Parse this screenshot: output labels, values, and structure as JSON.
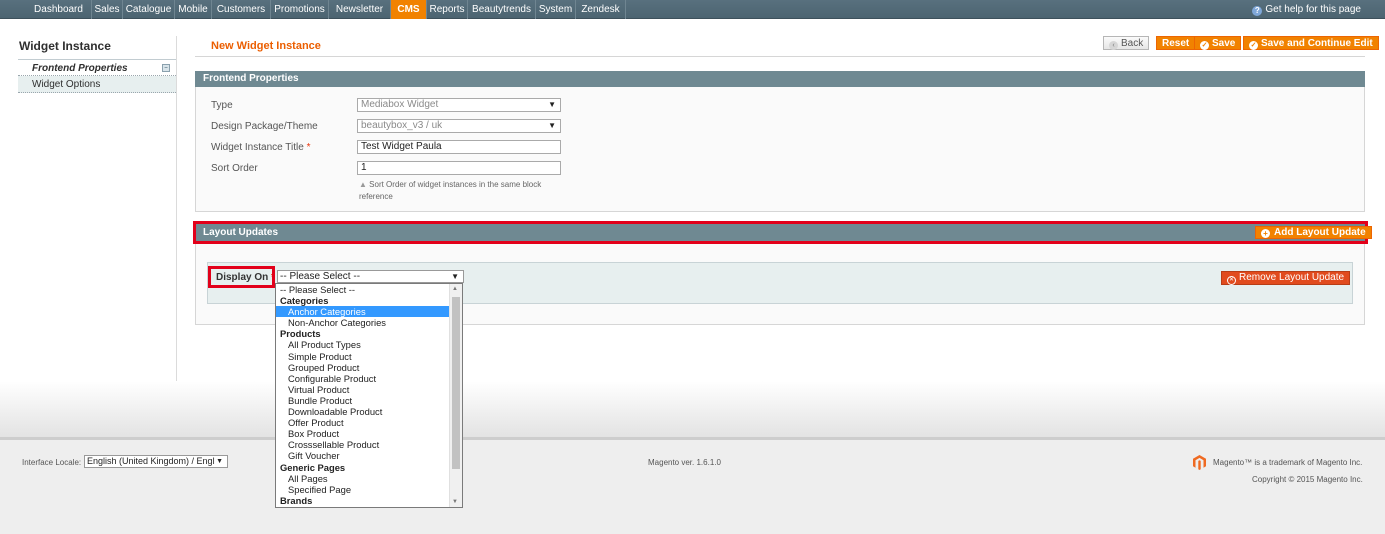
{
  "nav": {
    "items": [
      "Dashboard",
      "Sales",
      "Catalogue",
      "Mobile",
      "Customers",
      "Promotions",
      "Newsletter",
      "CMS",
      "Reports",
      "Beautytrends",
      "System",
      "Zendesk"
    ],
    "active": "CMS",
    "help": "Get help for this page",
    "help_icon": "question-circle-icon"
  },
  "sidebar": {
    "title": "Widget Instance",
    "tabs": [
      {
        "label": "Frontend Properties",
        "active": true
      },
      {
        "label": "Widget Options",
        "active": false
      }
    ]
  },
  "header": {
    "title": "New Widget Instance",
    "buttons": {
      "back": "Back",
      "reset": "Reset",
      "save": "Save",
      "save_continue": "Save and Continue Edit"
    }
  },
  "frontend": {
    "heading": "Frontend Properties",
    "type": {
      "label": "Type",
      "value": "Mediabox Widget"
    },
    "design": {
      "label": "Design Package/Theme",
      "value": "beautybox_v3 / uk"
    },
    "title": {
      "label": "Widget Instance Title",
      "required_mark": "*",
      "value": "Test Widget Paula"
    },
    "sort": {
      "label": "Sort Order",
      "value": "1",
      "note": "Sort Order of widget instances in the same block reference"
    }
  },
  "layout_updates": {
    "heading": "Layout Updates",
    "add_button": "Add Layout Update",
    "display_on_label": "Display On",
    "required_mark": "*",
    "display_on_value": "-- Please Select --",
    "remove_button": "Remove Layout Update",
    "options": [
      {
        "label": "-- Please Select --",
        "kind": "option"
      },
      {
        "label": "Categories",
        "kind": "group"
      },
      {
        "label": "Anchor Categories",
        "kind": "child",
        "highlighted": true
      },
      {
        "label": "Non-Anchor Categories",
        "kind": "child"
      },
      {
        "label": "Products",
        "kind": "group"
      },
      {
        "label": "All Product Types",
        "kind": "child"
      },
      {
        "label": "Simple Product",
        "kind": "child"
      },
      {
        "label": "Grouped Product",
        "kind": "child"
      },
      {
        "label": "Configurable Product",
        "kind": "child"
      },
      {
        "label": "Virtual Product",
        "kind": "child"
      },
      {
        "label": "Bundle Product",
        "kind": "child"
      },
      {
        "label": "Downloadable Product",
        "kind": "child"
      },
      {
        "label": "Offer Product",
        "kind": "child"
      },
      {
        "label": "Box Product",
        "kind": "child"
      },
      {
        "label": "Crosssellable Product",
        "kind": "child"
      },
      {
        "label": "Gift Voucher",
        "kind": "child"
      },
      {
        "label": "Generic Pages",
        "kind": "group"
      },
      {
        "label": "All Pages",
        "kind": "child"
      },
      {
        "label": "Specified Page",
        "kind": "child"
      },
      {
        "label": "Brands",
        "kind": "group"
      }
    ]
  },
  "footer": {
    "locale_label": "Interface Locale:",
    "locale_value": "English (United Kingdom) / Engl",
    "version": "Magento ver. 1.6.1.0",
    "trademark": "Magento™ is a trademark of Magento Inc.",
    "copyright": "Copyright © 2015 Magento Inc."
  },
  "colors": {
    "accent": "#f18200",
    "section_header": "#6f8992",
    "highlight_outline": "#e2001a",
    "selected_option": "#3399ff"
  }
}
